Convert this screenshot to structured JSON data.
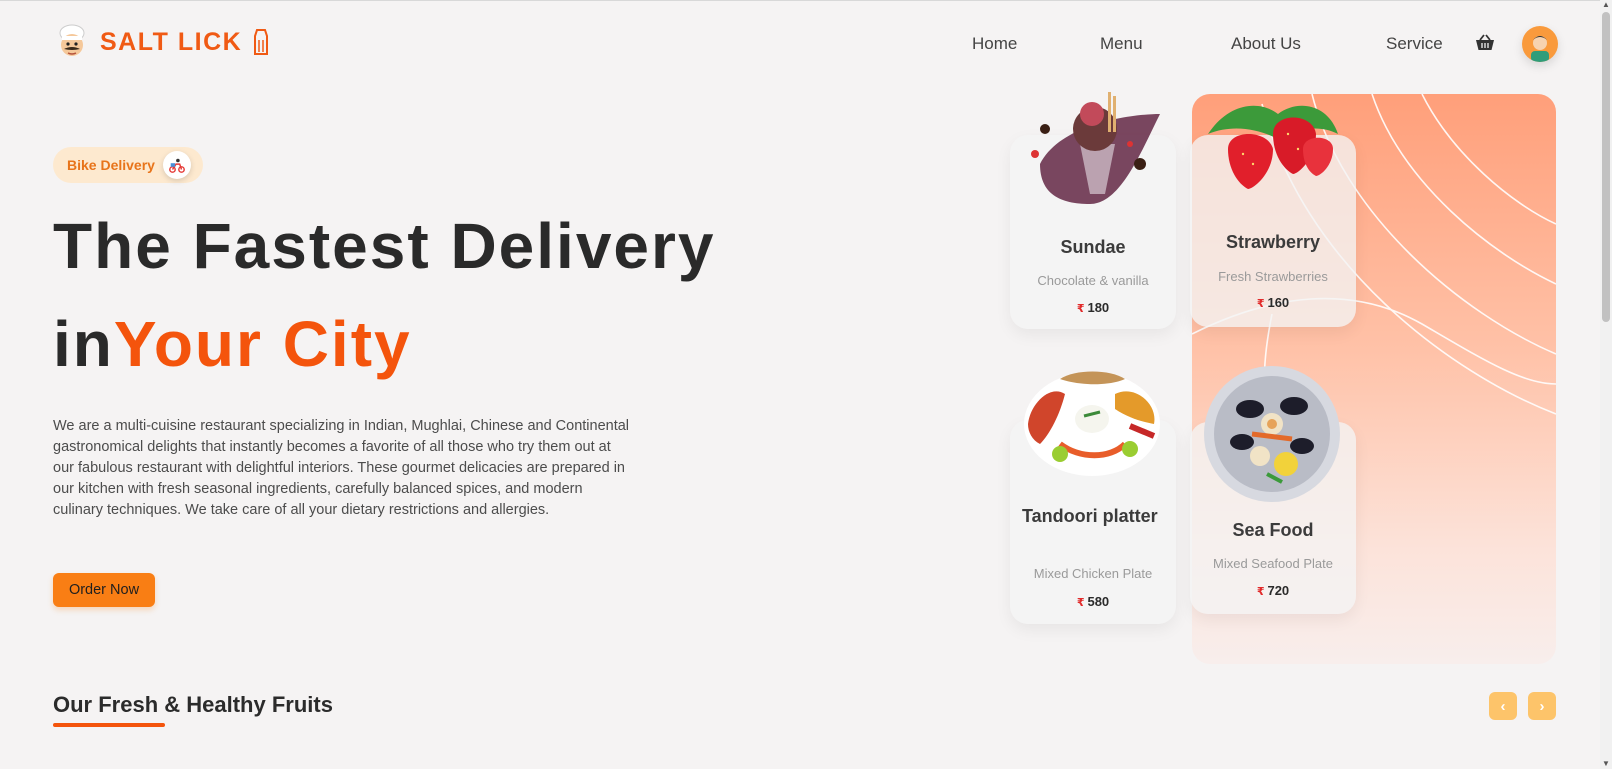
{
  "brand": {
    "name": "SALT LICK"
  },
  "nav": {
    "items": [
      "Home",
      "Menu",
      "About Us",
      "Service"
    ]
  },
  "hero": {
    "badge": "Bike Delivery",
    "title_line1": "The Fastest Delivery",
    "title_line2_prefix": "in",
    "title_line2_accent": "Your City",
    "description": "We are a multi-cuisine restaurant specializing in Indian, Mughlai, Chinese and Continental gastronomical delights that instantly becomes a favorite of all those who try them out at our fabulous restaurant with delightful interiors. These gourmet delicacies are prepared in our kitchen with fresh seasonal ingredients, carefully balanced spices, and modern culinary techniques. We take care of all your dietary restrictions and allergies.",
    "cta": "Order Now"
  },
  "cards": [
    {
      "name": "Sundae",
      "desc": "Chocolate & vanilla",
      "currency": "₹",
      "price": "180"
    },
    {
      "name": "Strawberry",
      "desc": "Fresh Strawberries",
      "currency": "₹",
      "price": "160"
    },
    {
      "name": "Tandoori platter",
      "desc": "Mixed Chicken Plate",
      "currency": "₹",
      "price": "580"
    },
    {
      "name": "Sea Food",
      "desc": "Mixed Seafood Plate",
      "currency": "₹",
      "price": "720"
    }
  ],
  "section": {
    "title": "Our Fresh & Healthy Fruits",
    "prev_icon": "‹",
    "next_icon": "›"
  },
  "icons": [
    "chef-logo-icon",
    "salt-shaker-icon",
    "basket-icon",
    "avatar",
    "scooter-icon",
    "chevron-left-icon",
    "chevron-right-icon"
  ],
  "colors": {
    "accent": "#f4540c",
    "button": "#f97e14",
    "badge_bg": "#fde9cf",
    "arrow_bg": "#fdc46a",
    "page_bg": "#f5f3f3"
  }
}
